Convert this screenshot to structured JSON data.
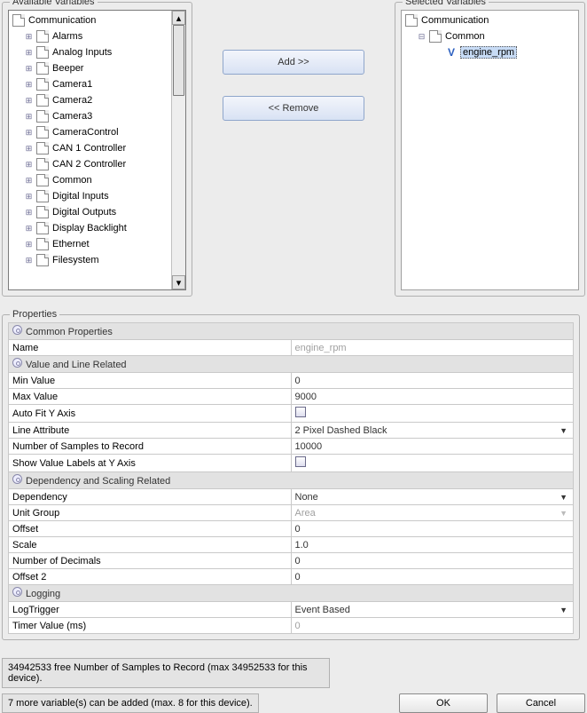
{
  "labels": {
    "avail": "Available Variables",
    "sel": "Selected Variables",
    "add": "Add >>",
    "remove": "<< Remove",
    "props": "Properties",
    "ok": "OK",
    "cancel": "Cancel"
  },
  "avail_root": "Communication",
  "avail_children": [
    "Alarms",
    "Analog Inputs",
    "Beeper",
    "Camera1",
    "Camera2",
    "Camera3",
    "CameraControl",
    "CAN 1 Controller",
    "CAN 2 Controller",
    "Common",
    "Digital Inputs",
    "Digital Outputs",
    "Display Backlight",
    "Ethernet",
    "Filesystem"
  ],
  "sel_root": "Communication",
  "sel_child": "Common",
  "sel_var": "engine_rpm",
  "sections": {
    "common": "Common Properties",
    "value": "Value and Line Related",
    "dep": "Dependency and Scaling Related",
    "log": "Logging"
  },
  "rows": {
    "name_l": "Name",
    "name_v": "engine_rpm",
    "min_l": "Min Value",
    "min_v": "0",
    "max_l": "Max Value",
    "max_v": "9000",
    "auto_l": "Auto Fit Y Axis",
    "line_l": "Line Attribute",
    "line_v": "2 Pixel Dashed Black",
    "samp_l": "Number of Samples to Record",
    "samp_v": "10000",
    "show_l": "Show Value Labels at Y Axis",
    "depn_l": "Dependency",
    "depn_v": "None",
    "unit_l": "Unit Group",
    "unit_v": "Area",
    "off_l": "Offset",
    "off_v": "0",
    "scale_l": "Scale",
    "scale_v": "1.0",
    "dec_l": "Number of Decimals",
    "dec_v": "0",
    "off2_l": "Offset 2",
    "off2_v": "0",
    "logt_l": "LogTrigger",
    "logt_v": "Event Based",
    "timer_l": "Timer Value (ms)",
    "timer_v": "0"
  },
  "status1": "34942533 free Number of Samples to Record (max 34952533 for this device).",
  "status2": "7 more variable(s) can be added (max. 8 for this device)."
}
